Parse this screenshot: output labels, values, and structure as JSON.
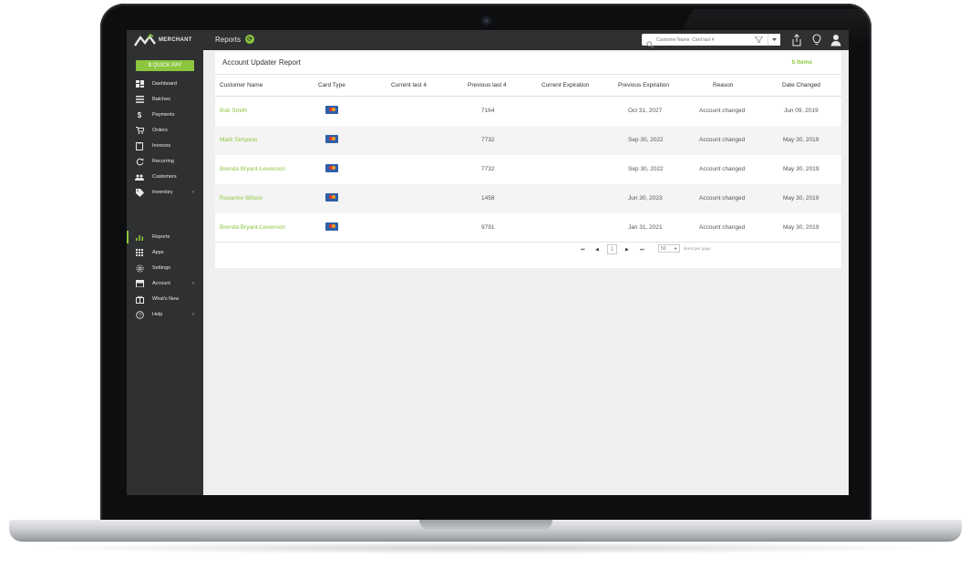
{
  "app": {
    "brand": "MERCHANT",
    "page": "Reports",
    "search_placeholder": "Customer Name, Card last 4"
  },
  "sidebar": {
    "quick_pay": "$ QUICK PAY",
    "items": [
      {
        "label": "Dashboard",
        "icon": "dashboard-icon"
      },
      {
        "label": "Batches",
        "icon": "batches-icon"
      },
      {
        "label": "Payments",
        "icon": "dollar-icon"
      },
      {
        "label": "Orders",
        "icon": "cart-icon"
      },
      {
        "label": "Invoices",
        "icon": "invoice-icon"
      },
      {
        "label": "Recurring",
        "icon": "recurring-icon"
      },
      {
        "label": "Customers",
        "icon": "customers-icon"
      },
      {
        "label": "Inventory",
        "icon": "tag-icon"
      },
      {
        "label": "Reports",
        "icon": "reports-icon"
      },
      {
        "label": "Apps",
        "icon": "apps-icon"
      },
      {
        "label": "Settings",
        "icon": "gear-icon"
      },
      {
        "label": "Account",
        "icon": "store-icon"
      },
      {
        "label": "What's New",
        "icon": "gift-icon"
      },
      {
        "label": "Help",
        "icon": "help-icon"
      }
    ]
  },
  "report": {
    "title": "Account Updater Report",
    "count": "5 Items",
    "columns": [
      "Customer Name",
      "Card Type",
      "Current last 4",
      "Previous last 4",
      "Current Expiration",
      "Previous Expiration",
      "Reason",
      "Date Changed"
    ],
    "rows": [
      {
        "name": "Bob Smith",
        "card": "mastercard",
        "current_last4": "",
        "previous_last4": "7164",
        "current_exp": "",
        "previous_exp": "Oct 31, 2027",
        "reason": "Account changed",
        "date": "Jun 09, 2019"
      },
      {
        "name": "Mark Simpson",
        "card": "mastercard",
        "current_last4": "",
        "previous_last4": "7732",
        "current_exp": "",
        "previous_exp": "Sep 30, 2022",
        "reason": "Account changed",
        "date": "May 30, 2019"
      },
      {
        "name": "Brenda Bryant-Levenson",
        "card": "mastercard",
        "current_last4": "",
        "previous_last4": "7732",
        "current_exp": "",
        "previous_exp": "Sep 30, 2022",
        "reason": "Account changed",
        "date": "May 30, 2019"
      },
      {
        "name": "Roxanne Wilson",
        "card": "mastercard",
        "current_last4": "",
        "previous_last4": "1458",
        "current_exp": "",
        "previous_exp": "Jun 30, 2023",
        "reason": "Account changed",
        "date": "May 30, 2019"
      },
      {
        "name": "Brenda Bryant-Levenson",
        "card": "mastercard",
        "current_last4": "",
        "previous_last4": "9791",
        "current_exp": "",
        "previous_exp": "Jan 31, 2021",
        "reason": "Account changed",
        "date": "May 30, 2019"
      }
    ]
  },
  "pager": {
    "page": "1",
    "page_size": "50",
    "page_size_label": "items per page"
  },
  "colors": {
    "accent": "#8cc63f",
    "sidebar": "#2f3032",
    "card_blue": "#2f5fa8"
  }
}
